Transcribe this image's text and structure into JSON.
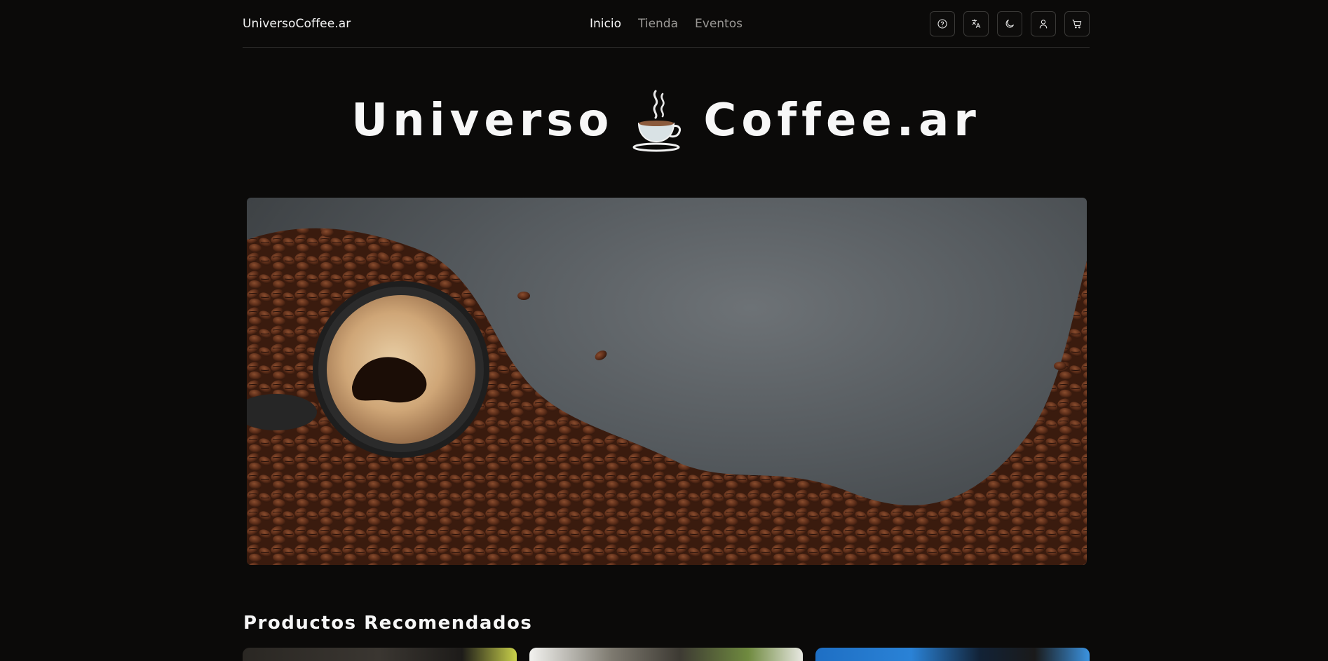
{
  "header": {
    "brand": "UniversoCoffee.ar",
    "nav": [
      {
        "label": "Inicio",
        "active": true
      },
      {
        "label": "Tienda",
        "active": false
      },
      {
        "label": "Eventos",
        "active": false
      }
    ],
    "icons": [
      "help-icon",
      "translate-icon",
      "moon-icon",
      "user-icon",
      "cart-icon"
    ]
  },
  "hero": {
    "title_left": "Universo",
    "title_right": "Coffee.ar",
    "emoji": "coffee-cup-icon"
  },
  "banner": {
    "image": "coffee-cup-and-beans-photo"
  },
  "section": {
    "title": "Productos Recomendados"
  },
  "colors": {
    "background": "#0b0a09",
    "text": "#f2f2f2",
    "muted": "#9a9895",
    "border": "#2c2b2a"
  }
}
